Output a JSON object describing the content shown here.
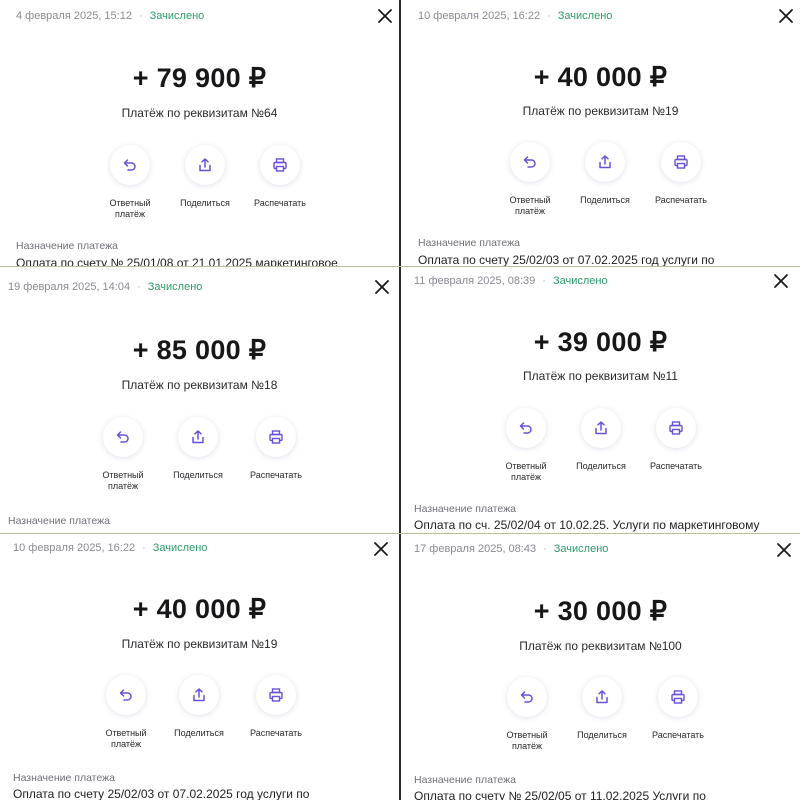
{
  "colors": {
    "status": "#2e9b6a",
    "icon_accent": "#6a50d8",
    "muted": "#8a8a92"
  },
  "actions": {
    "reply": "Ответный платёж",
    "share": "Поделиться",
    "print": "Распечатать"
  },
  "purpose_label": "Назначение платежа",
  "panels": [
    {
      "date": "4 февраля 2025, 15:12",
      "status": "Зачислено",
      "amount": "+ 79 900 ₽",
      "subtitle": "Платёж по реквизитам №64",
      "purpose": "Оплата по счету № 25/01/08 от 21.01.2025 маркетинговое"
    },
    {
      "date": "10 февраля 2025, 16:22",
      "status": "Зачислено",
      "amount": "+ 40 000 ₽",
      "subtitle": "Платёж по реквизитам №19",
      "purpose": "Оплата по счету 25/02/03 от 07.02.2025 год услуги по"
    },
    {
      "date": "19 февраля 2025, 14:04",
      "status": "Зачислено",
      "amount": "+ 85 000 ₽",
      "subtitle": "Платёж по реквизитам №18",
      "purpose": ""
    },
    {
      "date": "11 февраля 2025, 08:39",
      "status": "Зачислено",
      "amount": "+ 39 000 ₽",
      "subtitle": "Платёж по реквизитам №11",
      "purpose": "Оплата по сч. 25/02/04 от 10.02.25. Услуги по маркетинговому"
    },
    {
      "date": "10 февраля 2025, 16:22",
      "status": "Зачислено",
      "amount": "+ 40 000 ₽",
      "subtitle": "Платёж по реквизитам №19",
      "purpose": "Оплата по счету 25/02/03 от 07.02.2025 год услуги по"
    },
    {
      "date": "17 февраля 2025, 08:43",
      "status": "Зачислено",
      "amount": "+ 30 000 ₽",
      "subtitle": "Платёж по реквизитам №100",
      "purpose": "Оплата по счету № 25/02/05 от 11.02.2025 Услуги по"
    }
  ]
}
